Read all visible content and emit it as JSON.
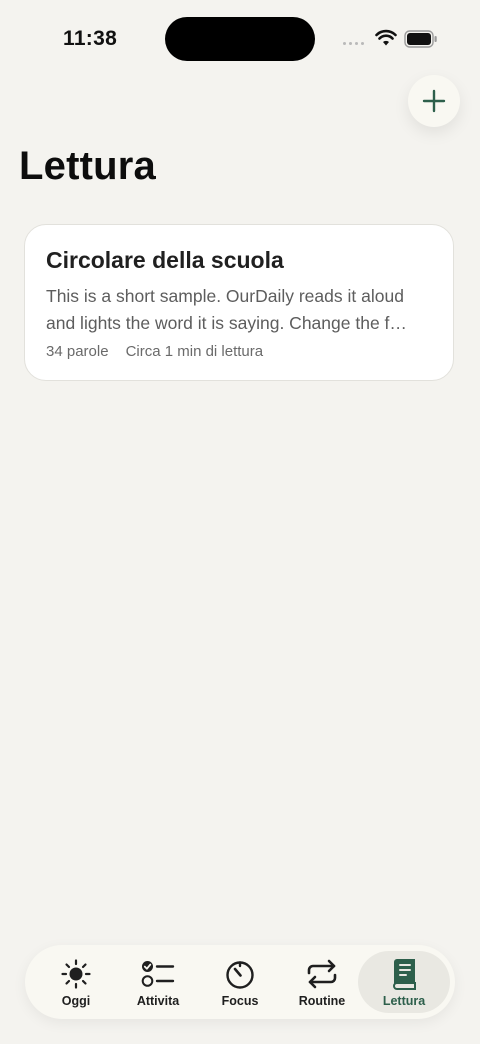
{
  "status_bar": {
    "time": "11:38"
  },
  "header": {
    "title": "Lettura"
  },
  "documents": [
    {
      "title": "Circolare della scuola",
      "excerpt_lines": [
        "This is a short sample. OurDaily reads it aloud",
        "and lights the word it is saying. Change the f…"
      ],
      "word_count": "34 parole",
      "read_time": "Circa 1 min di lettura"
    }
  ],
  "tabs": [
    {
      "label": "Oggi",
      "icon": "sun-icon"
    },
    {
      "label": "Attivita",
      "icon": "checklist-icon"
    },
    {
      "label": "Focus",
      "icon": "timer-icon"
    },
    {
      "label": "Routine",
      "icon": "repeat-icon"
    },
    {
      "label": "Lettura",
      "icon": "book-icon",
      "active": true
    }
  ],
  "colors": {
    "accent": "#2d5f4b",
    "background": "#f4f3ef",
    "card": "#ffffff"
  }
}
